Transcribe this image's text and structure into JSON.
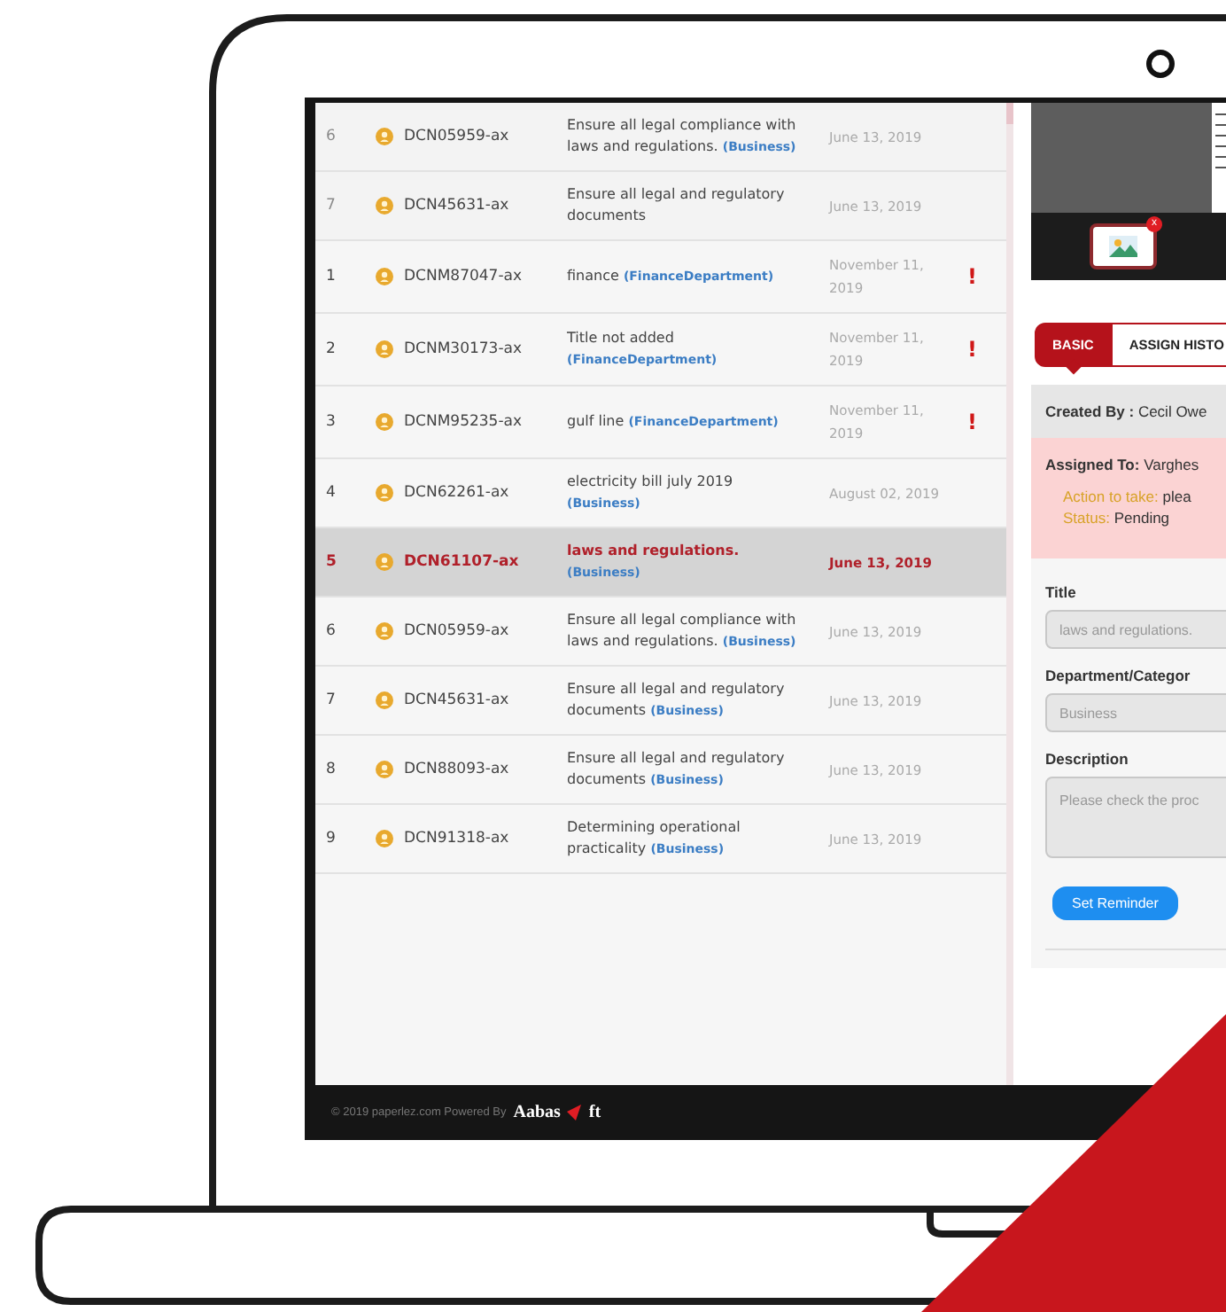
{
  "documents": [
    {
      "kind": "faded",
      "index": "6",
      "id": "DCN05959-ax",
      "title": "Ensure all legal compliance with laws and regulations.",
      "category": "(Business)",
      "date": "June 13, 2019",
      "selected": false
    },
    {
      "kind": "faded",
      "index": "7",
      "id": "DCN45631-ax",
      "title": "Ensure all legal and regulatory documents",
      "date": "June 13, 2019",
      "selected": false
    },
    {
      "kind": "normal",
      "index": "1",
      "id": "DCNM87047-ax",
      "title": "finance",
      "category": "(FinanceDepartment)",
      "date": "November 11, 2019",
      "flag": "!",
      "selected": false
    },
    {
      "kind": "normal",
      "index": "2",
      "id": "DCNM30173-ax",
      "title": "Title not added",
      "category": "(FinanceDepartment)",
      "date": "November 11, 2019",
      "flag": "!",
      "selected": false
    },
    {
      "kind": "normal",
      "index": "3",
      "id": "DCNM95235-ax",
      "title": "gulf line",
      "category": "(FinanceDepartment)",
      "date": "November 11, 2019",
      "flag": "!",
      "selected": false
    },
    {
      "kind": "normal",
      "index": "4",
      "id": "DCN62261-ax",
      "title": "electricity bill july 2019",
      "category": "(Business)",
      "date": "August 02, 2019",
      "selected": false
    },
    {
      "kind": "normal",
      "index": "5",
      "id": "DCN61107-ax",
      "title": "laws and regulations.",
      "category": "(Business)",
      "date": "June 13, 2019",
      "selected": true
    },
    {
      "kind": "normal",
      "index": "6",
      "id": "DCN05959-ax",
      "title": "Ensure all legal compliance with laws and regulations.",
      "category": "(Business)",
      "date": "June 13, 2019",
      "selected": false
    },
    {
      "kind": "normal",
      "index": "7",
      "id": "DCN45631-ax",
      "title": "Ensure all legal and regulatory documents",
      "category": "(Business)",
      "date": "June 13, 2019",
      "selected": false
    },
    {
      "kind": "normal",
      "index": "8",
      "id": "DCN88093-ax",
      "title": "Ensure all legal and regulatory documents",
      "category": "(Business)",
      "date": "June 13, 2019",
      "selected": false
    },
    {
      "kind": "normal",
      "index": "9",
      "id": "DCN91318-ax",
      "title": "Determining operational practicality",
      "category": "(Business)",
      "date": "June 13, 2019",
      "selected": false
    }
  ],
  "preview": {
    "badge": "x"
  },
  "tabs": [
    {
      "label": "BASIC",
      "selected": true
    },
    {
      "label": "ASSIGN HISTO",
      "selected": false
    }
  ],
  "created_by": "**Created By :** Cecil Owe",
  "assigned_to": "**Assigned To:** Varghes",
  "details": [
    {
      "label": "Action to take:",
      "value": "plea"
    },
    {
      "label": "Status:",
      "value": "Pending"
    }
  ],
  "form": {
    "fields": [
      {
        "kind": "input",
        "label": "Title",
        "value": "laws and regulations.",
        "disabled": true
      },
      {
        "kind": "input",
        "label": "Department/Categor",
        "value": "Business",
        "disabled": true
      },
      {
        "kind": "textarea",
        "label": "Description",
        "value": "Please check the proc",
        "disabled": true
      }
    ],
    "button": "Set Reminder"
  },
  "footer": {
    "text": "© 2019 paperlez.com Powered By",
    "logo_start": "Aabas",
    "logo_end": "ft"
  }
}
